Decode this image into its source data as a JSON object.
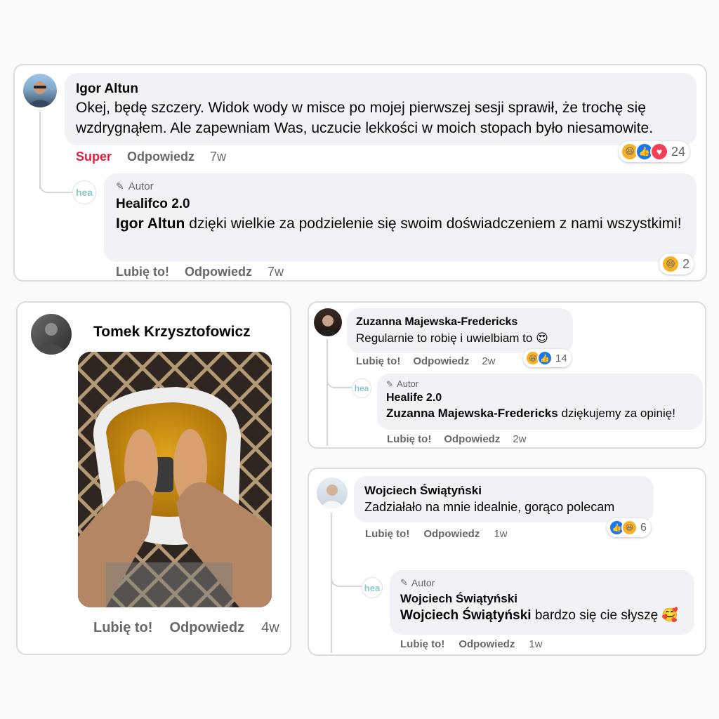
{
  "card1": {
    "comment": {
      "name": "Igor Altun",
      "text": "Okej, będę szczery. Widok wody w misce po mojej pierwszej sesji sprawił, że trochę się wzdrygnąłem. Ale zapewniam Was, uczucie lekkości w moich stopach było niesamowite.",
      "like_label": "Super",
      "reply_label": "Odpowiedz",
      "time": "7w",
      "reactions": [
        "laugh",
        "like",
        "love"
      ],
      "reaction_count": "24"
    },
    "reply": {
      "avatar_text": "hea",
      "author_label": "Autor",
      "name": "Healifco 2.0",
      "mention": "Igor Altun",
      "text": " dzięki wielkie za podzielenie się swoim doświadczeniem z nami wszystkimi!",
      "like_label": "Lubię to!",
      "reply_label": "Odpowiedz",
      "time": "7w",
      "reactions": [
        "laugh"
      ],
      "reaction_count": "2"
    }
  },
  "card2": {
    "name": "Tomek Krzysztofowicz",
    "like_label": "Lubię to!",
    "reply_label": "Odpowiedz",
    "time": "4w"
  },
  "card3": {
    "comment": {
      "name": "Zuzanna Majewska-Fredericks",
      "text": "Regularnie to robię i uwielbiam to 😍",
      "like_label": "Lubię to!",
      "reply_label": "Odpowiedz",
      "time": "2w",
      "reactions": [
        "laugh",
        "like"
      ],
      "reaction_count": "14"
    },
    "reply": {
      "avatar_text": "hea",
      "author_label": "Autor",
      "name": "Healife 2.0",
      "mention": "Zuzanna Majewska-Fredericks",
      "text": " dziękujemy za opinię!",
      "like_label": "Lubię to!",
      "reply_label": "Odpowiedz",
      "time": "2w"
    }
  },
  "card4": {
    "comment": {
      "name": "Wojciech Świątyński",
      "text": "Zadziałało na mnie idealnie, gorąco polecam",
      "like_label": "Lubię to!",
      "reply_label": "Odpowiedz",
      "time": "1w",
      "reactions": [
        "like",
        "laugh"
      ],
      "reaction_count": "6"
    },
    "reply": {
      "avatar_text": "hea",
      "author_label": "Autor",
      "name": "Wojciech Świątyński",
      "mention": "Wojciech Świątyński",
      "text": " bardzo się cie słyszę 🥰",
      "like_label": "Lubię to!",
      "reply_label": "Odpowiedz",
      "time": "1w"
    }
  },
  "colors": {
    "super": "#e41e3f",
    "like": "#1877f2",
    "laugh": "#f7b125",
    "love": "#f33e58",
    "meta": "#65676b",
    "bubble": "#f0f2f5"
  }
}
